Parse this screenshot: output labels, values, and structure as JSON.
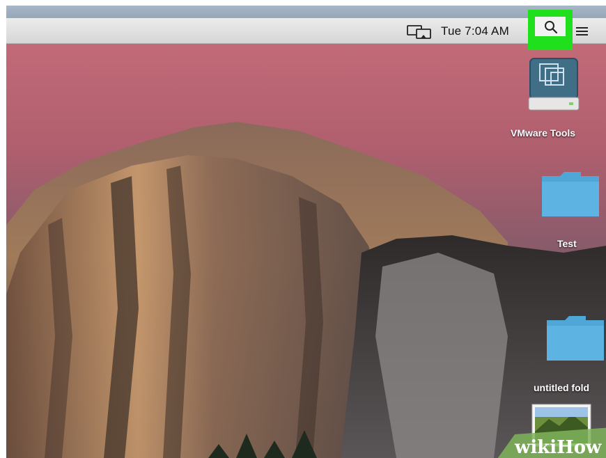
{
  "menubar": {
    "clock": "Tue 7:04 AM",
    "display_icon": "airplay-display-icon",
    "spotlight_icon": "search-icon",
    "menu_icon": "notification-center-icon"
  },
  "desktop": {
    "items": [
      {
        "label": "VMware Tools",
        "icon": "disk-image-icon"
      },
      {
        "label": "Test",
        "icon": "folder-icon"
      },
      {
        "label": "untitled fold",
        "icon": "folder-icon"
      },
      {
        "label": "",
        "icon": "image-file-icon"
      }
    ]
  },
  "highlight_color": "#20e01d",
  "watermark": "wikiHow"
}
